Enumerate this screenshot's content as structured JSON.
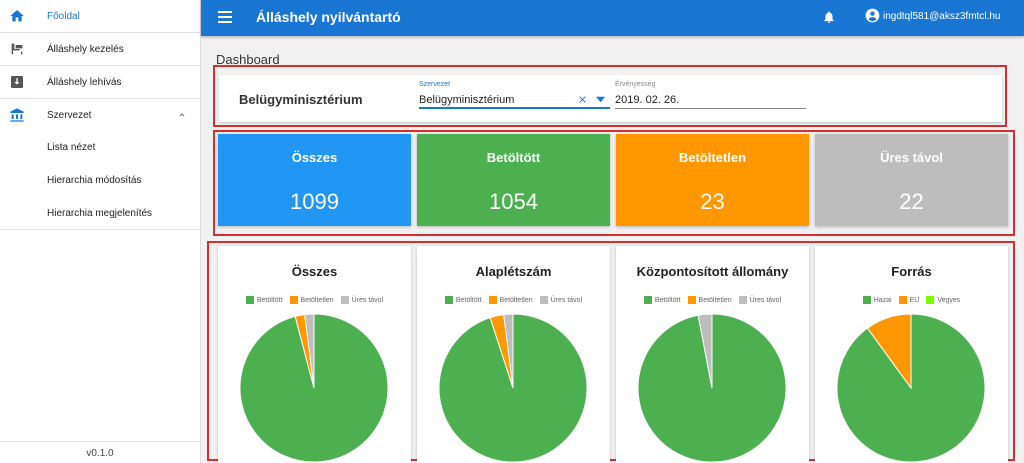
{
  "sidebar": {
    "items": [
      {
        "label": "Főoldal",
        "icon": "home-icon"
      },
      {
        "label": "Álláshely kezelés",
        "icon": "desk-icon"
      },
      {
        "label": "Álláshely lehívás",
        "icon": "download-box-icon"
      },
      {
        "label": "Szervezet",
        "icon": "institution-icon"
      }
    ],
    "subitems": [
      {
        "label": "Lista nézet"
      },
      {
        "label": "Hierarchia módosítás"
      },
      {
        "label": "Hierarchia megjelenítés"
      }
    ],
    "version": "v0.1.0"
  },
  "topbar": {
    "title": "Álláshely nyilvántartó",
    "user": "ingdtql581@aksz3fmtcl.hu"
  },
  "page": {
    "title": "Dashboard"
  },
  "filter": {
    "org_name": "Belügyminisztérium",
    "org_label": "Szervezet",
    "org_value": "Belügyminisztérium",
    "date_label": "Érvényesség",
    "date_value": "2019. 02. 26."
  },
  "stats": [
    {
      "title": "Összes",
      "value": "1099",
      "color": "#2196f3"
    },
    {
      "title": "Betöltött",
      "value": "1054",
      "color": "#4caf50"
    },
    {
      "title": "Betöltetlen",
      "value": "23",
      "color": "#ff9800"
    },
    {
      "title": "Üres távol",
      "value": "22",
      "color": "#bdbdbd"
    }
  ],
  "colors": {
    "accent": "#1976d2",
    "highlight_box": "#d32f2f"
  },
  "chart_data": [
    {
      "type": "pie",
      "title": "Összes",
      "categories": [
        "Betöltött",
        "Betöltetlen",
        "Üres távol"
      ],
      "values": [
        1054,
        23,
        22
      ],
      "colors": [
        "#4caf50",
        "#ff9800",
        "#bdbdbd"
      ]
    },
    {
      "type": "pie",
      "title": "Alaplétszám",
      "categories": [
        "Betöltött",
        "Betöltetlen",
        "Üres távol"
      ],
      "values": [
        95,
        3,
        2
      ],
      "colors": [
        "#4caf50",
        "#ff9800",
        "#bdbdbd"
      ]
    },
    {
      "type": "pie",
      "title": "Központosított állomány",
      "categories": [
        "Betöltött",
        "Betöltetlen",
        "Üres távol"
      ],
      "values": [
        97,
        0,
        3
      ],
      "colors": [
        "#4caf50",
        "#ff9800",
        "#bdbdbd"
      ]
    },
    {
      "type": "pie",
      "title": "Forrás",
      "categories": [
        "Hazai",
        "EU",
        "Vegyes"
      ],
      "values": [
        90,
        10,
        0
      ],
      "colors": [
        "#4caf50",
        "#ff9800",
        "#76ff03"
      ]
    }
  ]
}
